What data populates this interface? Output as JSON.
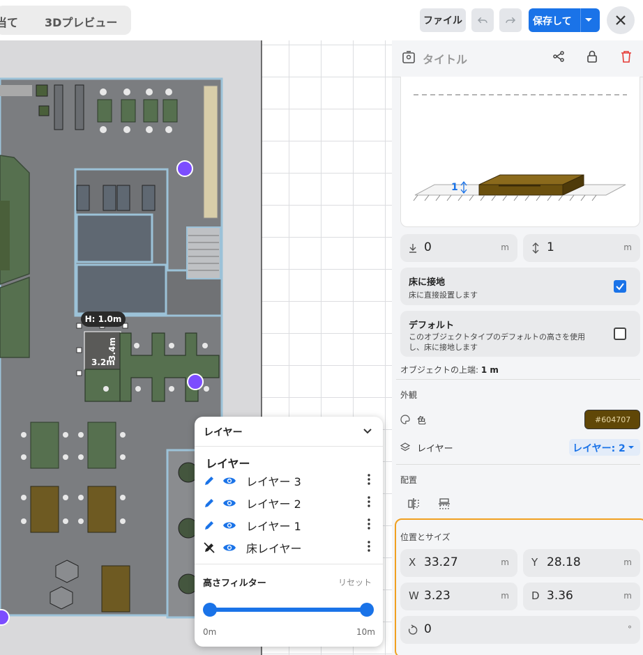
{
  "topbar": {
    "tab_partial": "当て",
    "tab_3d": "3Dプレビュー",
    "file": "ファイル",
    "save": "保存して"
  },
  "canvas": {
    "dim_h": "H: 1.0m",
    "dim_w": "3.2m",
    "dim_d": "3.4m"
  },
  "panel": {
    "title": "タイトル",
    "elevation": "0",
    "height": "1",
    "unit": "m",
    "preview_height": "1",
    "floor_title": "床に接地",
    "floor_desc": "床に直接設置します",
    "floor_checked": true,
    "default_title": "デフォルト",
    "default_desc": "このオブジェクトタイプのデフォルトの高さを使用し、床に接地します",
    "default_checked": false,
    "top_label": "オブジェクトの上端:",
    "top_value": "1 m",
    "appearance": "外観",
    "color_label": "色",
    "color_value": "#604707",
    "layer_label": "レイヤー",
    "layer_value": "レイヤー: 2",
    "arrangement": "配置",
    "pos_size": "位置とサイズ",
    "x_label": "X",
    "x": "33.27",
    "y_label": "Y",
    "y": "28.18",
    "w_label": "W",
    "w": "3.23",
    "d_label": "D",
    "d": "3.36",
    "rotation": "0",
    "deg": "°"
  },
  "layers": {
    "header": "レイヤー",
    "title": "レイヤー",
    "items": [
      {
        "name": "レイヤー 3"
      },
      {
        "name": "レイヤー 2"
      },
      {
        "name": "レイヤー 1"
      },
      {
        "name": "床レイヤー"
      }
    ],
    "height_filter": "高さフィルター",
    "reset": "リセット",
    "min": "0m",
    "max": "10m",
    "range": [
      0,
      10
    ]
  },
  "colors": {
    "accent": "#1a73e8",
    "object": "#604707",
    "selection": "#f0a020",
    "desk": "#4e6d4a"
  }
}
